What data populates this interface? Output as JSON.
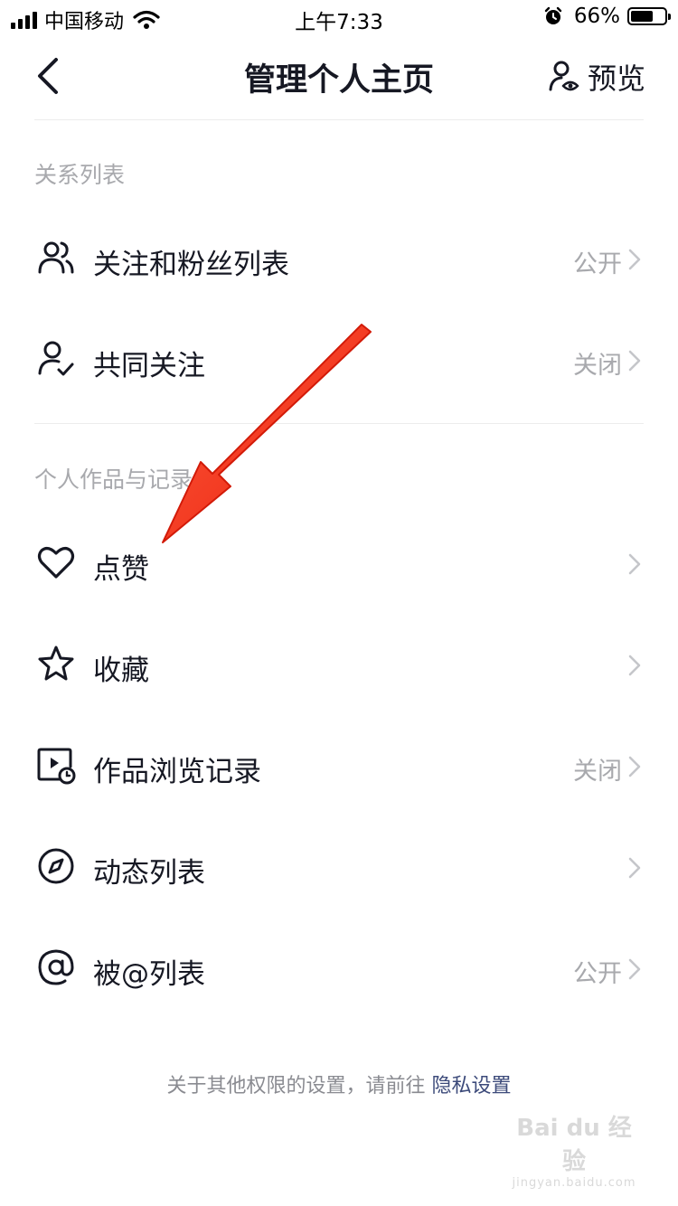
{
  "status_bar": {
    "carrier": "中国移动",
    "time": "上午7:33",
    "battery_percent_text": "66%",
    "battery_level": 0.66
  },
  "nav": {
    "title": "管理个人主页",
    "preview_label": "预览"
  },
  "sections": [
    {
      "title": "关系列表",
      "items": [
        {
          "label": "关注和粉丝列表",
          "status": "公开",
          "icon": "users-icon"
        },
        {
          "label": "共同关注",
          "status": "关闭",
          "icon": "user-check-icon"
        }
      ]
    },
    {
      "title": "个人作品与记录",
      "items": [
        {
          "label": "点赞",
          "status": "",
          "icon": "heart-icon"
        },
        {
          "label": "收藏",
          "status": "",
          "icon": "star-icon"
        },
        {
          "label": "作品浏览记录",
          "status": "关闭",
          "icon": "video-history-icon"
        },
        {
          "label": "动态列表",
          "status": "",
          "icon": "compass-icon"
        },
        {
          "label": "被@列表",
          "status": "公开",
          "icon": "at-icon"
        }
      ]
    }
  ],
  "footer": {
    "note": "关于其他权限的设置，请前往",
    "link": "隐私设置"
  },
  "watermark": {
    "main": "Bai du 经验",
    "sub": "jingyan.baidu.com"
  },
  "colors": {
    "text_primary": "#161823",
    "text_secondary": "#a8a9ad",
    "link": "#3c4a7a",
    "annotation_arrow": "#f5321e"
  }
}
